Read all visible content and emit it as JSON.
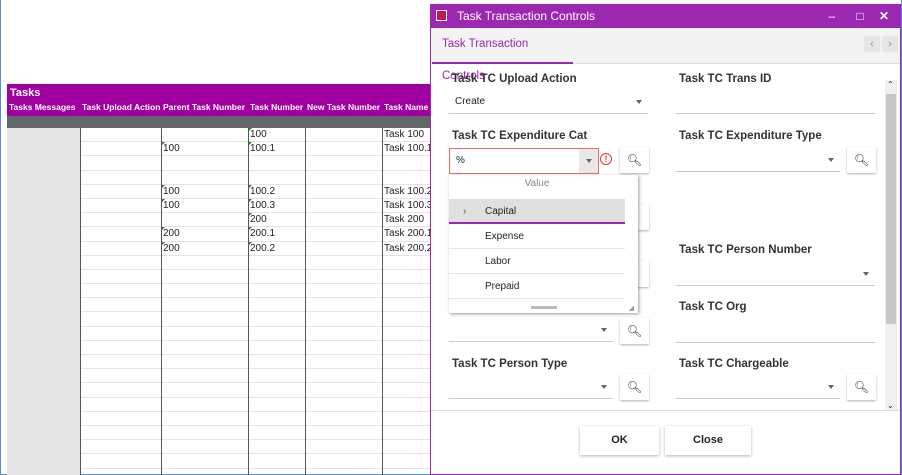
{
  "sheet": {
    "title": "Tasks",
    "columns": [
      "Tasks Messages",
      "Task Upload Action",
      "Parent Task Number",
      "Task Number",
      "New Task Number",
      "Task Name"
    ],
    "rows": [
      [
        "",
        "",
        "",
        "100",
        "",
        "Task 100"
      ],
      [
        "",
        "",
        "100",
        "100.1",
        "",
        "Task 100.1"
      ],
      [
        "",
        "",
        "",
        "",
        "",
        ""
      ],
      [
        "",
        "",
        "",
        "",
        "",
        ""
      ],
      [
        "",
        "",
        "100",
        "100.2",
        "",
        "Task 100.2"
      ],
      [
        "",
        "",
        "100",
        "100.3",
        "",
        "Task 100.3"
      ],
      [
        "",
        "",
        "",
        "200",
        "",
        "Task 200"
      ],
      [
        "",
        "",
        "200",
        "200.1",
        "",
        "Task 200.1"
      ],
      [
        "",
        "",
        "200",
        "200.2",
        "",
        "Task 200.2"
      ]
    ]
  },
  "dialog": {
    "title": "Task Transaction Controls",
    "tab": "Task Transaction Controls",
    "fields": {
      "upload_action": {
        "label": "Task TC Upload Action",
        "value": "Create"
      },
      "trans_id": {
        "label": "Task TC Trans ID",
        "value": ""
      },
      "exp_cat": {
        "label": "Task TC Expenditure Cat",
        "value": "%"
      },
      "exp_type": {
        "label": "Task TC Expenditure Type",
        "value": ""
      },
      "person_number": {
        "label": "Task TC Person Number",
        "value": ""
      },
      "org": {
        "label": "Task TC Org",
        "value": ""
      },
      "person_type": {
        "label": "Task TC Person Type",
        "value": ""
      },
      "chargeable": {
        "label": "Task TC Chargeable",
        "value": ""
      }
    },
    "dropdown": {
      "header": "Value",
      "options": [
        "Capital",
        "Expense",
        "Labor",
        "Prepaid"
      ],
      "selected": "Capital"
    },
    "ok": "OK",
    "close": "Close"
  },
  "colors": {
    "accent": "#9c27b0",
    "sheet_header": "#a000a0",
    "error": "#e53935"
  }
}
